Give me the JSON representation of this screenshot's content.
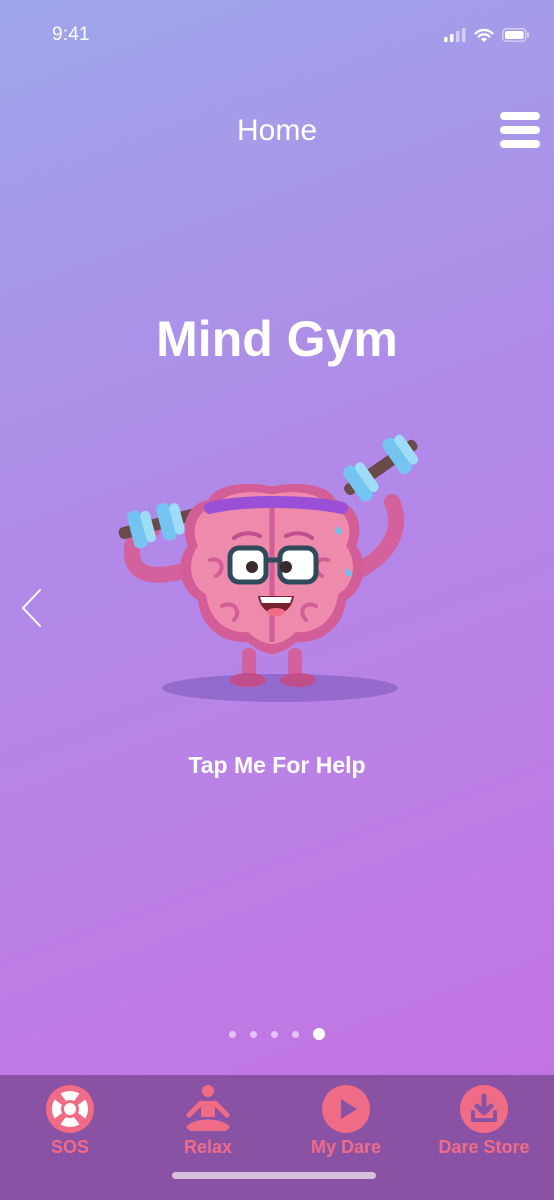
{
  "status_bar": {
    "time": "9:41"
  },
  "header": {
    "title": "Home"
  },
  "main": {
    "title": "Mind Gym",
    "help_text": "Tap Me For Help"
  },
  "pager": {
    "total": 5,
    "active_index": 4
  },
  "tabs": [
    {
      "id": "sos",
      "label": "SOS",
      "icon": "lifebuoy-icon"
    },
    {
      "id": "relax",
      "label": "Relax",
      "icon": "meditation-icon"
    },
    {
      "id": "my-dare",
      "label": "My Dare",
      "icon": "play-icon"
    },
    {
      "id": "dare-store",
      "label": "Dare Store",
      "icon": "download-icon"
    }
  ],
  "colors": {
    "tab_accent": "#f06c86",
    "tab_bar_bg": "#8a52a4",
    "brain": "#ee8aab"
  }
}
